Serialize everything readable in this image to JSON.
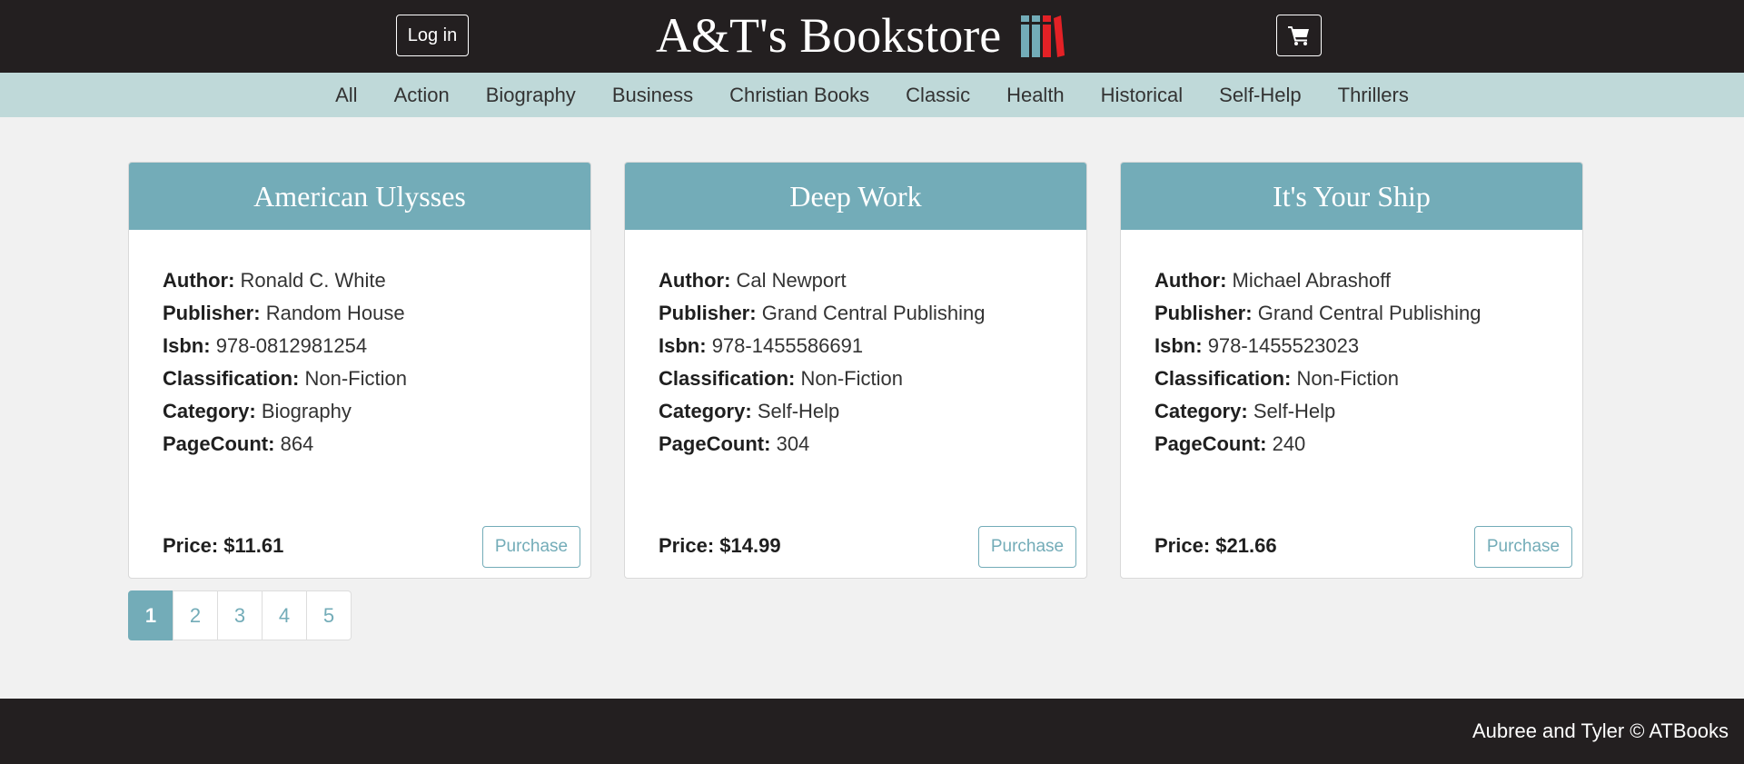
{
  "header": {
    "login_label": "Log in",
    "title": "A&T's Bookstore",
    "logo_icon": "books-icon",
    "cart_icon": "shopping-cart-icon",
    "colors": {
      "background": "#231f20",
      "logo_teal": "#73acb8",
      "logo_red": "#e32126"
    }
  },
  "categories": [
    "All",
    "Action",
    "Biography",
    "Business",
    "Christian Books",
    "Classic",
    "Health",
    "Historical",
    "Self-Help",
    "Thrillers"
  ],
  "field_labels": {
    "author": "Author:",
    "publisher": "Publisher:",
    "isbn": "Isbn:",
    "classification": "Classification:",
    "category": "Category:",
    "pagecount": "PageCount:",
    "price": "Price:"
  },
  "books": [
    {
      "title": "American Ulysses",
      "author": "Ronald C. White",
      "publisher": "Random House",
      "isbn": "978-0812981254",
      "classification": "Non-Fiction",
      "category": "Biography",
      "pagecount": "864",
      "price": "$11.61",
      "purchase_label": "Purchase"
    },
    {
      "title": "Deep Work",
      "author": "Cal Newport",
      "publisher": "Grand Central Publishing",
      "isbn": "978-1455586691",
      "classification": "Non-Fiction",
      "category": "Self-Help",
      "pagecount": "304",
      "price": "$14.99",
      "purchase_label": "Purchase"
    },
    {
      "title": "It's Your Ship",
      "author": "Michael Abrashoff",
      "publisher": "Grand Central Publishing",
      "isbn": "978-1455523023",
      "classification": "Non-Fiction",
      "category": "Self-Help",
      "pagecount": "240",
      "price": "$21.66",
      "purchase_label": "Purchase"
    }
  ],
  "pagination": {
    "pages": [
      "1",
      "2",
      "3",
      "4",
      "5"
    ],
    "current": "1"
  },
  "footer": {
    "text": "Aubree and Tyler © ATBooks"
  },
  "theme": {
    "accent": "#73acb8",
    "nav_bg": "#bfd9d9",
    "page_bg": "#f1f1f1"
  }
}
